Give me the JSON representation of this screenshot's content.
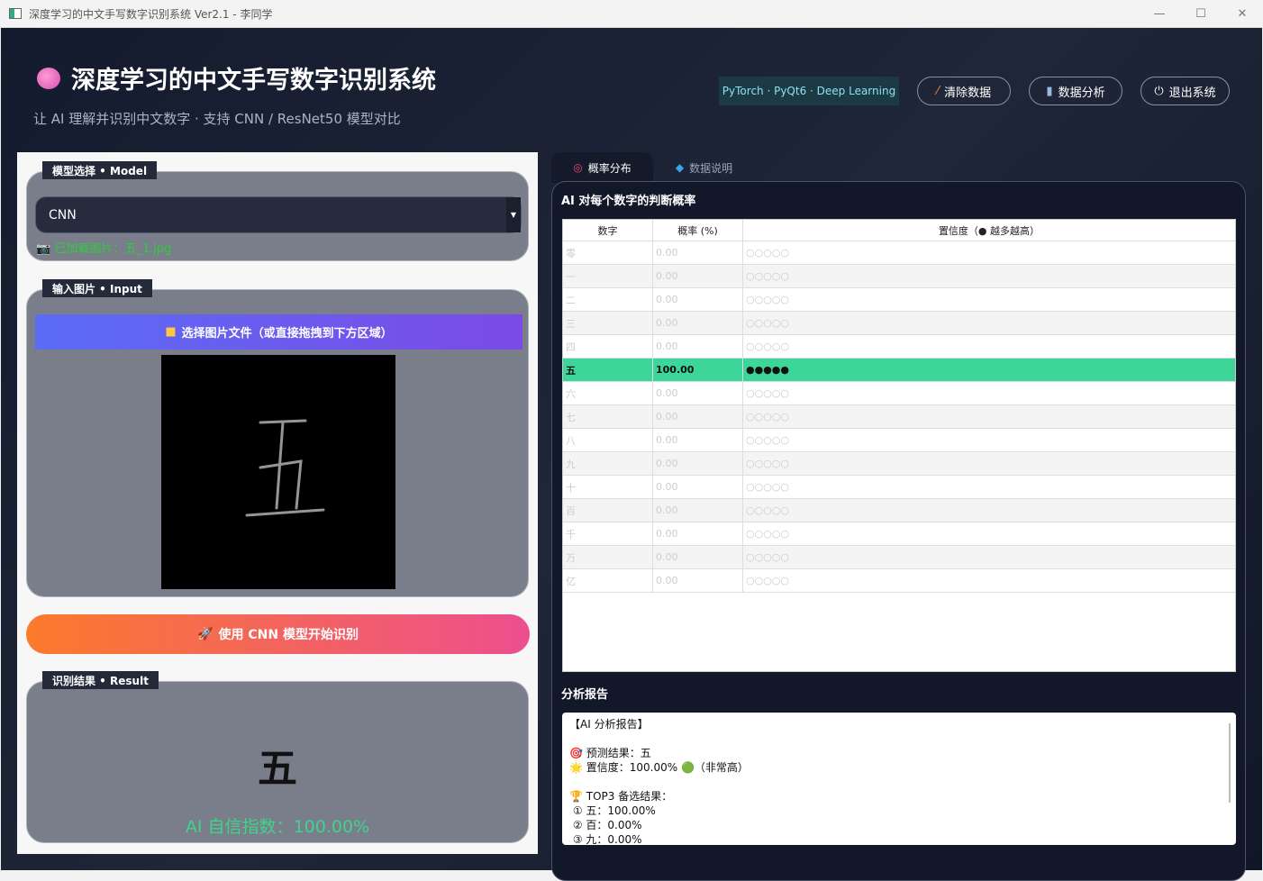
{
  "window": {
    "title": "深度学习的中文手写数字识别系统 Ver2.1 - 李同学",
    "controls": [
      "—",
      "☐",
      "✕"
    ]
  },
  "header": {
    "title": "深度学习的中文手写数字识别系统",
    "subtitle": "让 AI 理解并识别中文数字 · 支持 CNN / ResNet50 模型对比",
    "tag": "PyTorch · PyQt6 · Deep Learning",
    "clear_label": "清除数据",
    "analysis_label": "数据分析",
    "exit_label": "退出系统"
  },
  "model_group": {
    "label": "模型选择 • Model",
    "selected": "CNN",
    "loaded": "已加载图片：五_1.jpg"
  },
  "input_group": {
    "label": "输入图片 • Input",
    "pick_label": "选择图片文件（或直接拖拽到下方区域）"
  },
  "run_label": "使用 CNN 模型开始识别",
  "result_group": {
    "label": "识别结果 • Result",
    "char": "五",
    "confidence": "AI 自信指数：100.00%"
  },
  "tabs": [
    {
      "label": "概率分布",
      "icon": "target-icon"
    },
    {
      "label": "数据说明",
      "icon": "gem-icon"
    }
  ],
  "prob": {
    "title": "AI 对每个数字的判断概率",
    "headers": [
      "数字",
      "概率 (%)",
      "置信度（● 越多越高）"
    ],
    "rows": [
      {
        "digit": "零",
        "prob": "0.00",
        "dots": "○○○○○"
      },
      {
        "digit": "一",
        "prob": "0.00",
        "dots": "○○○○○"
      },
      {
        "digit": "二",
        "prob": "0.00",
        "dots": "○○○○○"
      },
      {
        "digit": "三",
        "prob": "0.00",
        "dots": "○○○○○"
      },
      {
        "digit": "四",
        "prob": "0.00",
        "dots": "○○○○○"
      },
      {
        "digit": "五",
        "prob": "100.00",
        "dots": "●●●●●",
        "selected": true
      },
      {
        "digit": "六",
        "prob": "0.00",
        "dots": "○○○○○"
      },
      {
        "digit": "七",
        "prob": "0.00",
        "dots": "○○○○○"
      },
      {
        "digit": "八",
        "prob": "0.00",
        "dots": "○○○○○"
      },
      {
        "digit": "九",
        "prob": "0.00",
        "dots": "○○○○○"
      },
      {
        "digit": "十",
        "prob": "0.00",
        "dots": "○○○○○"
      },
      {
        "digit": "百",
        "prob": "0.00",
        "dots": "○○○○○"
      },
      {
        "digit": "千",
        "prob": "0.00",
        "dots": "○○○○○"
      },
      {
        "digit": "万",
        "prob": "0.00",
        "dots": "○○○○○"
      },
      {
        "digit": "亿",
        "prob": "0.00",
        "dots": "○○○○○"
      }
    ]
  },
  "report": {
    "title": "分析报告",
    "text": "【AI 分析报告】\n\n🎯 预测结果：五\n🌟 置信度：100.00% 🟢（非常高）\n\n🏆 TOP3 备选结果：\n ① 五：100.00%\n ② 百：0.00%\n ③ 九：0.00%"
  },
  "colors": {
    "accent": "#3dd598",
    "background": "#141b2e",
    "run_start": "#fb7a2c",
    "run_end": "#ec4f8e",
    "pick_start": "#5b6cf7",
    "pick_end": "#7b4ae6"
  }
}
